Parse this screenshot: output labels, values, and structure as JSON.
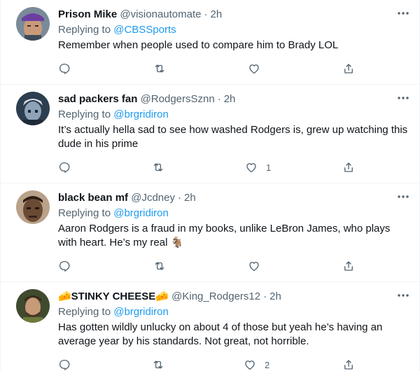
{
  "tweets": [
    {
      "name": "Prison Mike",
      "handle": "@visionautomate",
      "separator": "·",
      "time": "2h",
      "replying_prefix": "Replying to ",
      "replying_to": "@CBSSports",
      "text": "Remember when people used to compare him to Brady LOL",
      "like_count": "",
      "avatar_colors": {
        "bg": "#7a8a99",
        "hair": "#6b3fa0",
        "skin": "#c99a7a"
      }
    },
    {
      "name": "sad packers fan",
      "handle": "@RodgersSznn",
      "separator": "·",
      "time": "2h",
      "replying_prefix": "Replying to ",
      "replying_to": "@brgridiron",
      "text": "It’s actually hella sad to see how washed Rodgers is, grew up watching this dude in his prime",
      "like_count": "1",
      "avatar_colors": {
        "bg": "#2c3e50",
        "hair": "#d9dde3",
        "skin": "#8ea3b8"
      }
    },
    {
      "name": "black bean mf",
      "handle": "@Jcdney",
      "separator": "·",
      "time": "2h",
      "replying_prefix": "Replying to ",
      "replying_to": "@brgridiron",
      "text": "Aaron Rodgers is a fraud in my books, unlike LeBron James, who plays with heart. He’s my real 🐐",
      "like_count": "",
      "avatar_colors": {
        "bg": "#b9a18a",
        "hair": "#2b1d14",
        "skin": "#6b4a35"
      }
    },
    {
      "name": "🧀STINKY CHEESE🧀",
      "handle": "@King_Rodgers12",
      "separator": "·",
      "time": "2h",
      "replying_prefix": "Replying to ",
      "replying_to": "@brgridiron",
      "text": "Has gotten wildly unlucky on about 4 of those but yeah he’s having an average year by his standards. Not great, not horrible.",
      "like_count": "2",
      "avatar_colors": {
        "bg": "#3f4a2e",
        "hair": "#3b2a1c",
        "skin": "#c79a78"
      }
    }
  ],
  "colors": {
    "accent": "#1d9bf0",
    "secondary_text": "#536471",
    "divider": "#eff3f4"
  }
}
